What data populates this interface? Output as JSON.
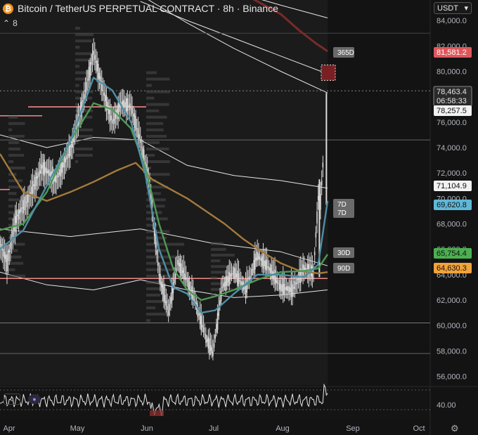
{
  "header": {
    "icon": "bitcoin-icon",
    "title": "Bitcoin / TetherUS PERPETUAL CONTRACT · 8h · Binance",
    "indicator_count": "8",
    "currency": "USDT"
  },
  "colors": {
    "background": "#131313",
    "price": "#d9d9d9",
    "ma_fast": "#4f8fa6",
    "ma_mid": "#4e9a54",
    "ma_slow": "#a47a3c",
    "ma_365": "#7a2a2a",
    "envelope": "#e6e6e6",
    "hline_pink": "#f08a8a",
    "tag_red": "#e0575b",
    "tag_blue": "#5fb8d8",
    "tag_green": "#4caf50",
    "tag_orange": "#f2a33a",
    "tag_gray": "#6a6a6a"
  },
  "chart_data": {
    "type": "line",
    "x_ticks": [
      "Apr",
      "May",
      "Jun",
      "Jul",
      "Aug",
      "Sep",
      "Oct"
    ],
    "y_ticks": [
      "56,000.0",
      "58,000.0",
      "60,000.0",
      "62,000.0",
      "64,000.0",
      "66,000.0",
      "68,000.0",
      "70,000.0",
      "72,000.0",
      "74,000.0",
      "76,000.0",
      "78,000.0",
      "80,000.0",
      "82,000.0",
      "84,000.0"
    ],
    "ylim": [
      55000,
      85000
    ],
    "price_points": [
      [
        0,
        66500
      ],
      [
        3,
        65000
      ],
      [
        7,
        68500
      ],
      [
        12,
        70000
      ],
      [
        18,
        72500
      ],
      [
        24,
        71500
      ],
      [
        30,
        73800
      ],
      [
        36,
        78000
      ],
      [
        40,
        81500
      ],
      [
        44,
        78500
      ],
      [
        48,
        76000
      ],
      [
        52,
        77500
      ],
      [
        56,
        77200
      ],
      [
        60,
        74500
      ],
      [
        64,
        71000
      ],
      [
        68,
        64000
      ],
      [
        72,
        61000
      ],
      [
        76,
        65000
      ],
      [
        80,
        63500
      ],
      [
        84,
        61500
      ],
      [
        88,
        59000
      ],
      [
        91,
        57800
      ],
      [
        95,
        63000
      ],
      [
        100,
        64200
      ],
      [
        105,
        62800
      ],
      [
        110,
        65500
      ],
      [
        115,
        64500
      ],
      [
        120,
        63000
      ],
      [
        125,
        62800
      ],
      [
        130,
        64500
      ],
      [
        134,
        64200
      ],
      [
        136,
        70000
      ],
      [
        137,
        69800
      ],
      [
        140,
        78200
      ]
    ],
    "ma_fast_points": [
      [
        0,
        66000
      ],
      [
        10,
        67500
      ],
      [
        20,
        71000
      ],
      [
        30,
        74500
      ],
      [
        40,
        79500
      ],
      [
        48,
        78500
      ],
      [
        56,
        76000
      ],
      [
        62,
        72000
      ],
      [
        68,
        66000
      ],
      [
        74,
        63000
      ],
      [
        80,
        62500
      ],
      [
        86,
        61000
      ],
      [
        92,
        61200
      ],
      [
        100,
        62500
      ],
      [
        110,
        64000
      ],
      [
        120,
        64000
      ],
      [
        130,
        63800
      ],
      [
        136,
        64800
      ],
      [
        140,
        69800
      ]
    ],
    "ma_mid_points": [
      [
        0,
        67500
      ],
      [
        10,
        68000
      ],
      [
        20,
        70500
      ],
      [
        30,
        74500
      ],
      [
        40,
        77500
      ],
      [
        48,
        77000
      ],
      [
        56,
        75500
      ],
      [
        62,
        72500
      ],
      [
        68,
        68000
      ],
      [
        74,
        64500
      ],
      [
        80,
        62800
      ],
      [
        86,
        62000
      ],
      [
        92,
        62300
      ],
      [
        100,
        62800
      ],
      [
        110,
        63600
      ],
      [
        120,
        64200
      ],
      [
        130,
        64300
      ],
      [
        136,
        64500
      ],
      [
        140,
        65600
      ]
    ],
    "ma_slow_points": [
      [
        0,
        73500
      ],
      [
        10,
        70500
      ],
      [
        20,
        69800
      ],
      [
        30,
        70500
      ],
      [
        40,
        71300
      ],
      [
        50,
        72200
      ],
      [
        58,
        72800
      ],
      [
        65,
        71500
      ],
      [
        72,
        70800
      ],
      [
        80,
        70000
      ],
      [
        88,
        69000
      ],
      [
        96,
        68000
      ],
      [
        104,
        66800
      ],
      [
        112,
        65800
      ],
      [
        120,
        64900
      ],
      [
        128,
        64300
      ],
      [
        136,
        64100
      ],
      [
        140,
        64200
      ]
    ],
    "ma_365_points": [
      [
        100,
        86500
      ],
      [
        110,
        85500
      ],
      [
        120,
        84500
      ],
      [
        128,
        83200
      ],
      [
        135,
        82200
      ],
      [
        140,
        81581
      ]
    ],
    "tags": [
      {
        "text": "78,463.4",
        "sub": "06:58:33",
        "kind": "gray"
      },
      {
        "text": "81,581.2",
        "kind": "red"
      },
      {
        "text": "78,257.5",
        "kind": "white"
      },
      {
        "text": "71,104.9",
        "kind": "white"
      },
      {
        "text": "69,620.8",
        "kind": "blue"
      },
      {
        "text": "65,754.4",
        "kind": "green"
      },
      {
        "text": "64,630.3",
        "kind": "orange"
      }
    ],
    "line_labels": [
      "365D",
      "7D",
      "7D",
      "30D",
      "90D"
    ],
    "rsi": {
      "label": "40.00",
      "value": 40
    }
  }
}
